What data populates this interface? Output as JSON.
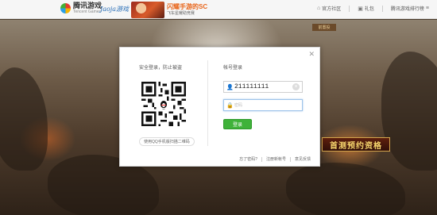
{
  "header": {
    "logo_cn": "腾讯游戏",
    "logo_en": "Tencent Games",
    "brand2": "Jaoja游戏",
    "promo_title": "闪耀手游的SC",
    "promo_sub": "飞车星耀助竞赛",
    "nav": [
      {
        "icon": "home-icon",
        "label": "官方社区"
      },
      {
        "icon": "gift-icon",
        "label": "礼包"
      },
      {
        "label": "腾讯游戏排行榜"
      }
    ]
  },
  "scene": {
    "tag": "前置投",
    "cta": "首测预约资格"
  },
  "dialog": {
    "qr_title": "安全登录，防止被盗",
    "qr_hint": "使用QQ手机版扫描二维码",
    "account_title": "帐号登录",
    "username_value": "211111111",
    "password_placeholder": "密码",
    "login_label": "登录",
    "footer_links": [
      "忘了密码?",
      "注册新帐号",
      "意见反馈"
    ]
  },
  "colors": {
    "login_green": "#3fb23a",
    "input_focus": "#9ec4ea",
    "cta_gold": "#f7d66e"
  }
}
